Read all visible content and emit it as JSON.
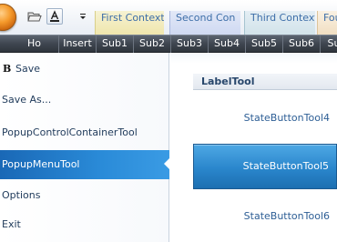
{
  "colors": {
    "accent": "#2a86cc",
    "menu_selected": "#1f74c0",
    "tab_bar": "#3f4650",
    "link_text": "#2d5e95"
  },
  "quick_access": {
    "icons": [
      "app-orb-icon",
      "open-folder-icon",
      "font-color-icon",
      "customize-dropdown-icon"
    ]
  },
  "context_tabs": [
    {
      "label": "First Context"
    },
    {
      "label": "Second  Con"
    },
    {
      "label": "Third Context"
    },
    {
      "label": "Fou"
    }
  ],
  "ribbon_tabs": [
    {
      "label": "Ho"
    },
    {
      "label": "Insert"
    },
    {
      "label": "Sub1"
    },
    {
      "label": "Sub2"
    },
    {
      "label": "Sub3"
    },
    {
      "label": "Sub4"
    },
    {
      "label": "Sub5"
    },
    {
      "label": "Sub6"
    },
    {
      "label": "Su"
    }
  ],
  "app_menu": {
    "items": [
      {
        "label": "Save",
        "icon": "bold-b-icon"
      },
      {
        "label": "Save As..."
      },
      {
        "label": "PopupControlContainerTool"
      },
      {
        "label": "PopupMenuTool",
        "selected": true
      },
      {
        "label": "Options"
      },
      {
        "label": "Exit"
      }
    ]
  },
  "panel": {
    "label_tool": "LabelTool",
    "buttons": [
      {
        "label": "StateButtonTool4"
      },
      {
        "label": "StateButtonTool5",
        "active": true
      },
      {
        "label": "StateButtonTool6"
      }
    ]
  }
}
